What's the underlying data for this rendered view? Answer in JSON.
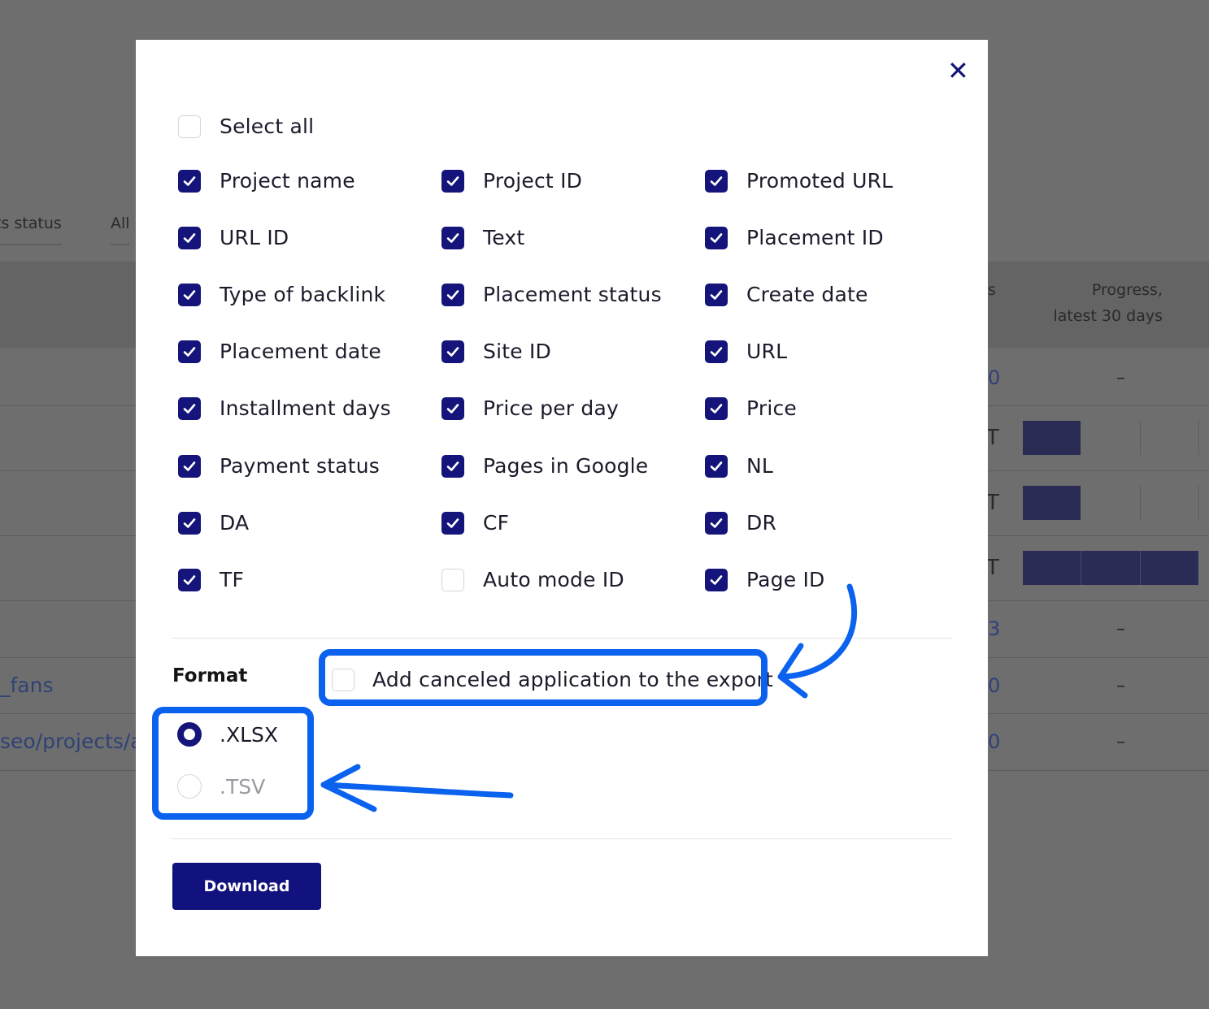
{
  "background": {
    "tabs": [
      "ts status",
      "All"
    ],
    "columns": [
      "ss",
      "Progress,",
      "latest 30 days"
    ],
    "cells": [
      "0",
      "T",
      "T",
      "T",
      "3",
      "0",
      "0"
    ],
    "dashes": [
      "–",
      "–",
      "–",
      "–"
    ],
    "links": [
      "_fans",
      "seo/projects/a"
    ],
    "bars": [
      0.33,
      0.33,
      1.0
    ]
  },
  "modal": {
    "close_icon": "close-icon",
    "select_all": {
      "label": "Select all",
      "checked": false
    },
    "fields": [
      {
        "label": "Project name",
        "checked": true
      },
      {
        "label": "Project ID",
        "checked": true
      },
      {
        "label": "Promoted URL",
        "checked": true
      },
      {
        "label": "URL ID",
        "checked": true
      },
      {
        "label": "Text",
        "checked": true
      },
      {
        "label": "Placement ID",
        "checked": true
      },
      {
        "label": "Type of backlink",
        "checked": true
      },
      {
        "label": "Placement status",
        "checked": true
      },
      {
        "label": "Create date",
        "checked": true
      },
      {
        "label": "Placement date",
        "checked": true
      },
      {
        "label": "Site ID",
        "checked": true
      },
      {
        "label": "URL",
        "checked": true
      },
      {
        "label": "Installment days",
        "checked": true
      },
      {
        "label": "Price per day",
        "checked": true
      },
      {
        "label": "Price",
        "checked": true
      },
      {
        "label": "Payment status",
        "checked": true
      },
      {
        "label": "Pages in Google",
        "checked": true
      },
      {
        "label": "NL",
        "checked": true
      },
      {
        "label": "DA",
        "checked": true
      },
      {
        "label": "CF",
        "checked": true
      },
      {
        "label": "DR",
        "checked": true
      },
      {
        "label": "TF",
        "checked": true
      },
      {
        "label": "Auto mode ID",
        "checked": false
      },
      {
        "label": "Page ID",
        "checked": true
      }
    ],
    "format": {
      "title": "Format",
      "add_canceled": {
        "label": "Add canceled application to the export",
        "checked": false
      },
      "options": [
        {
          "label": ".XLSX",
          "selected": true
        },
        {
          "label": ".TSV",
          "selected": false
        }
      ]
    },
    "download_label": "Download"
  },
  "colors": {
    "accent": "#14147a",
    "annotation": "#0a62ee",
    "overlay": "#6e6e6e"
  }
}
